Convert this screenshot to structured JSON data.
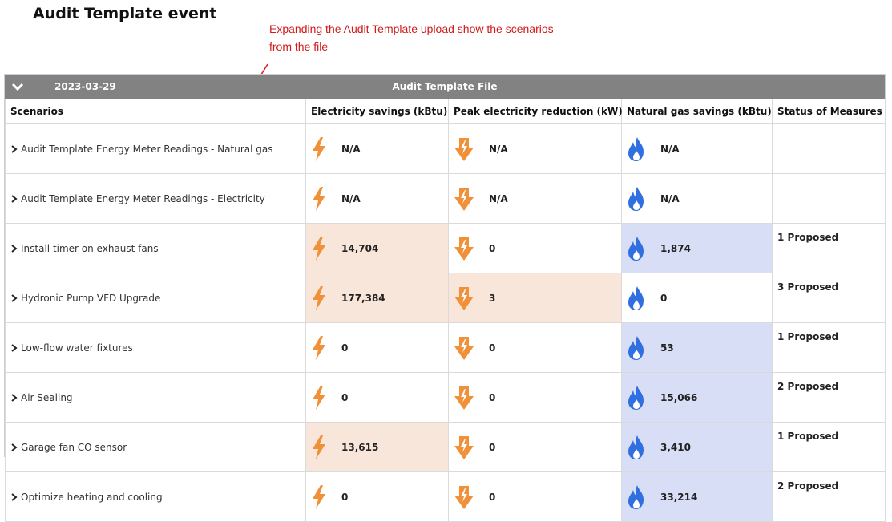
{
  "page": {
    "title": "Audit Template event",
    "annotation": "Expanding the Audit Template upload show the scenarios from the file"
  },
  "event": {
    "date": "2023-03-29",
    "source": "Audit Template File"
  },
  "columns": {
    "scenarios": "Scenarios",
    "electricity": "Electricity savings (kBtu)",
    "peak": "Peak electricity reduction (kW)",
    "gas": "Natural gas savings (kBtu)",
    "status": "Status of Measures"
  },
  "colors": {
    "electricity_icon": "#f0913a",
    "gas_icon": "#2f6fe0",
    "electricity_highlight": "#f9e6da",
    "gas_highlight": "#d9def7",
    "header_bar": "#828282",
    "annotation": "#d11a1a"
  },
  "icons": {
    "electricity": "lightning-bolt-icon",
    "peak": "down-arrow-bolt-icon",
    "gas": "flame-icon",
    "expand": "chevron-right-icon",
    "collapse": "chevron-down-icon"
  },
  "rows": [
    {
      "scenario": "Audit Template Energy Meter Readings - Natural gas",
      "electricity": "N/A",
      "peak": "N/A",
      "gas": "N/A",
      "status": "",
      "elec_hl": false,
      "peak_hl": false,
      "gas_hl": false
    },
    {
      "scenario": "Audit Template Energy Meter Readings - Electricity",
      "electricity": "N/A",
      "peak": "N/A",
      "gas": "N/A",
      "status": "",
      "elec_hl": false,
      "peak_hl": false,
      "gas_hl": false
    },
    {
      "scenario": "Install timer on exhaust fans",
      "electricity": "14,704",
      "peak": "0",
      "gas": "1,874",
      "status": "1 Proposed",
      "elec_hl": true,
      "peak_hl": false,
      "gas_hl": true
    },
    {
      "scenario": "Hydronic Pump VFD Upgrade",
      "electricity": "177,384",
      "peak": "3",
      "gas": "0",
      "status": "3 Proposed",
      "elec_hl": true,
      "peak_hl": true,
      "gas_hl": false
    },
    {
      "scenario": "Low-flow water fixtures",
      "electricity": "0",
      "peak": "0",
      "gas": "53",
      "status": "1 Proposed",
      "elec_hl": false,
      "peak_hl": false,
      "gas_hl": true
    },
    {
      "scenario": "Air Sealing",
      "electricity": "0",
      "peak": "0",
      "gas": "15,066",
      "status": "2 Proposed",
      "elec_hl": false,
      "peak_hl": false,
      "gas_hl": true
    },
    {
      "scenario": "Garage fan CO sensor",
      "electricity": "13,615",
      "peak": "0",
      "gas": "3,410",
      "status": "1 Proposed",
      "elec_hl": true,
      "peak_hl": false,
      "gas_hl": true
    },
    {
      "scenario": "Optimize heating and cooling",
      "electricity": "0",
      "peak": "0",
      "gas": "33,214",
      "status": "2 Proposed",
      "elec_hl": false,
      "peak_hl": false,
      "gas_hl": true
    }
  ]
}
